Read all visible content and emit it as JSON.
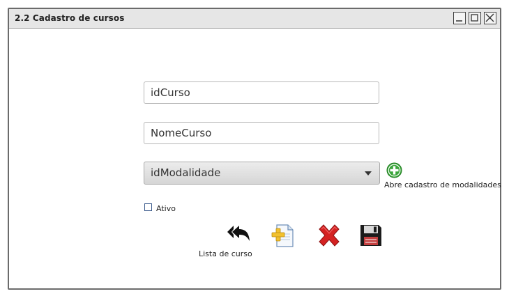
{
  "window": {
    "title": "2.2 Cadastro de cursos",
    "controls": [
      "minimize-icon",
      "maximize-icon",
      "close-icon"
    ]
  },
  "form": {
    "id_curso": {
      "placeholder": "idCurso",
      "value": ""
    },
    "nome_curso": {
      "placeholder": "NomeCurso",
      "value": ""
    },
    "modalidade": {
      "selected": "idModalidade"
    },
    "add_modalidade_label": "Abre cadastro de modalidades",
    "ativo_label": "Ativo",
    "ativo_checked": false
  },
  "actions": {
    "back_icon": "reply-all-icon",
    "back_label": "Lista de curso",
    "new_icon": "new-document-icon",
    "delete_icon": "delete-x-icon",
    "save_icon": "floppy-disk-icon"
  },
  "colors": {
    "titlebar": "#e6e6e6",
    "add_green": "#3aa53a",
    "delete_red": "#d42222",
    "new_yellow": "#f2c12e"
  }
}
